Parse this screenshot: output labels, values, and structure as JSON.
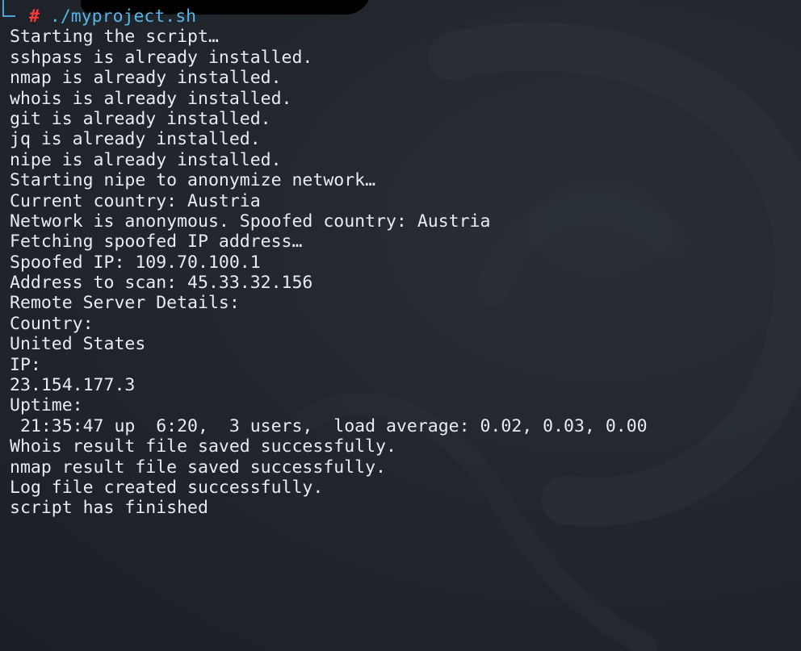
{
  "terminal": {
    "prompt_symbol": "#",
    "command": "./myproject.sh",
    "lines": [
      "Starting the script…",
      "sshpass is already installed.",
      "nmap is already installed.",
      "whois is already installed.",
      "git is already installed.",
      "jq is already installed.",
      "nipe is already installed.",
      "Starting nipe to anonymize network…",
      "Current country: Austria",
      "Network is anonymous. Spoofed country: Austria",
      "Fetching spoofed IP address…",
      "Spoofed IP: 109.70.100.1",
      "Address to scan: 45.33.32.156",
      "Remote Server Details:",
      "Country:",
      "United States",
      "IP:",
      "23.154.177.3",
      "Uptime:",
      " 21:35:47 up  6:20,  3 users,  load average: 0.02, 0.03, 0.00",
      "Whois result file saved successfully.",
      "nmap result file saved successfully.",
      "Log file created successfully.",
      "script has finished"
    ]
  },
  "colors": {
    "background": "#22262d",
    "text": "#e9ebee",
    "prompt_hash": "#ff3b3b",
    "command": "#56b6e8",
    "prompt_corner": "#4aa6d6"
  },
  "icons": {
    "background_logo": "kali-dragon-watermark"
  }
}
